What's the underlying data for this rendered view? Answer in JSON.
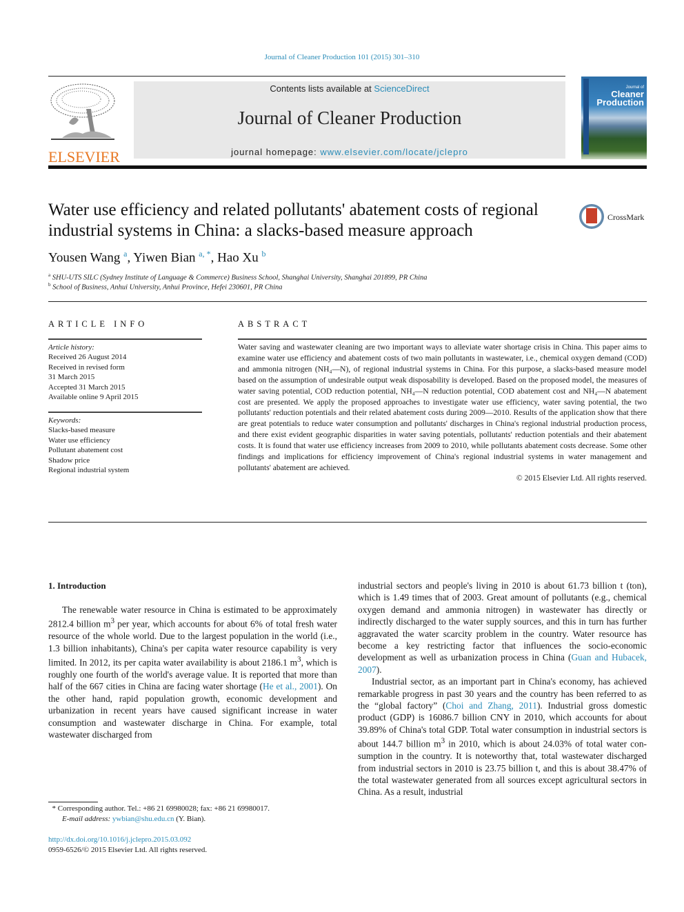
{
  "running_head": "Journal of Cleaner Production 101 (2015) 301–310",
  "publisher": {
    "logo_word": "ELSEVIER",
    "logo_icon": "elsevier-tree-icon"
  },
  "masthead": {
    "contents_prefix": "Contents lists available at ",
    "contents_link": "ScienceDirect",
    "journal_title": "Journal of Cleaner Production",
    "homepage_prefix": "journal homepage: ",
    "homepage_link": "www.elsevier.com/locate/jclepro"
  },
  "cover": {
    "small": "Journal of",
    "line1": "Cleaner",
    "line2": "Production"
  },
  "crossmark": {
    "label": "CrossMark",
    "icon": "crossmark-icon"
  },
  "article": {
    "title": "Water use efficiency and related pollutants' abatement costs of regional industrial systems in China: a slacks-based measure approach",
    "authors": [
      {
        "name": "Yousen Wang",
        "sup": "a"
      },
      {
        "name": "Yiwen Bian",
        "sup": "a, *"
      },
      {
        "name": "Hao Xu",
        "sup": "b"
      }
    ],
    "affiliations": [
      {
        "mark": "a",
        "text": "SHU-UTS SILC (Sydney Institute of Language & Commerce) Business School, Shanghai University, Shanghai 201899, PR China"
      },
      {
        "mark": "b",
        "text": "School of Business, Anhui University, Anhui Province, Hefei 230601, PR China"
      }
    ]
  },
  "article_info": {
    "heading": "ARTICLE INFO",
    "history_label": "Article history:",
    "history": [
      "Received 26 August 2014",
      "Received in revised form",
      "31 March 2015",
      "Accepted 31 March 2015",
      "Available online 9 April 2015"
    ],
    "keywords_label": "Keywords:",
    "keywords": [
      "Slacks-based measure",
      "Water use efficiency",
      "Pollutant abatement cost",
      "Shadow price",
      "Regional industrial system"
    ]
  },
  "abstract": {
    "heading": "ABSTRACT",
    "text": "Water saving and wastewater cleaning are two important ways to alleviate water shortage crisis in China. This paper aims to examine water use efficiency and abatement costs of two main pollutants in wastewater, i.e., chemical oxygen demand (COD) and ammonia nitrogen (NH₄—N), of regional industrial systems in China. For this purpose, a slacks-based measure model based on the assumption of unde­sirable output weak disposability is developed. Based on the proposed model, the measures of water saving potential, COD reduction potential, NH₄—N reduction potential, COD abatement cost and NH₄—N abatement cost are presented. We apply the proposed approaches to investigate water use efficiency, water saving potential, the two pollutants' reduction potentials and their related abatement costs during 2009—2010. Results of the application show that there are great potentials to reduce water consumption and pollutants' discharges in China's regional industrial production process, and there exist evident geographic disparities in water saving potentials, pollutants' reduction potentials and their abatement costs. It is found that water use efficiency increases from 2009 to 2010, while pollutants abatement costs decrease. Some other findings and implications for efficiency improvement of China's regional industrial systems in water management and pollutants' abatement are achieved.",
    "copyright": "© 2015 Elsevier Ltd. All rights reserved."
  },
  "introduction": {
    "heading": "1.  Introduction",
    "left_col": {
      "p1_a": "The renewable water resource in China is estimated to be approximately 2812.4 billion m",
      "p1_sup1": "3",
      "p1_b": " per year, which accounts for about 6% of total fresh water resource of the whole world. Due to the largest population in the world (i.e., 1.3 billion inhabitants), China's per capita water resource capability is very limited. In 2012, its per capita water availability is about 2186.1 m",
      "p1_sup2": "3",
      "p1_c": ", which is roughly one fourth of the world's average value. It is reported that more than half of the 667 cities in China are facing water shortage (",
      "p1_cite": "He et al., 2001",
      "p1_d": "). On the other hand, rapid population growth, economic development and urbanization in recent years have caused significant increase in water consumption and wastewater discharge in China. For example, total wastewater discharged from"
    },
    "right_col": {
      "p1_a": "industrial sectors and people's living in 2010 is about 61.73 billion t (ton), which is 1.49 times that of 2003. Great amount of pol­lutants (e.g., chemical oxygen demand and ammonia nitrogen) in wastewater has directly or indirectly discharged to the water supply sources, and this in turn has further aggravated the water scarcity problem in the country. Water resource has become a key restricting factor that influences the socio-economic development as well as urbanization process in China (",
      "p1_cite": "Guan and Hubacek, 2007",
      "p1_b": ").",
      "p2_a": "Industrial sector, as an important part in China's economy, has achieved remarkable progress in past 30 years and the country has been referred to as the “global factory” (",
      "p2_cite": "Choi and Zhang, 2011",
      "p2_b": "). Industrial gross domestic product (GDP) is 16086.7 billion CNY in 2010, which accounts for about 39.89% of China's total GDP. Total water consumption in industrial sectors is about 144.7 billion m",
      "p2_sup": "3",
      "p2_c": " in 2010, which is about 24.03% of total water con­sumption in the country. It is noteworthy that, total wastewater discharged from industrial sectors in 2010 is 23.75 billion t, and this is about 38.47% of the total wastewater generated from all sources except agricultural sectors in China. As a result, industrial"
    }
  },
  "footnote": {
    "mark": "*",
    "corresponding": "Corresponding author. Tel.: +86 21 69980028; fax: +86 21 69980017.",
    "email_label": "E-mail address:",
    "email": "ywbian@shu.edu.cn",
    "email_suffix": " (Y. Bian)."
  },
  "doi": {
    "link": "http://dx.doi.org/10.1016/j.jclepro.2015.03.092",
    "issn_line": "0959-6526/© 2015 Elsevier Ltd. All rights reserved."
  },
  "colors": {
    "link": "#2a8cb8",
    "elsevier_orange": "#e87722",
    "masthead_bg": "#e8e8e8"
  }
}
